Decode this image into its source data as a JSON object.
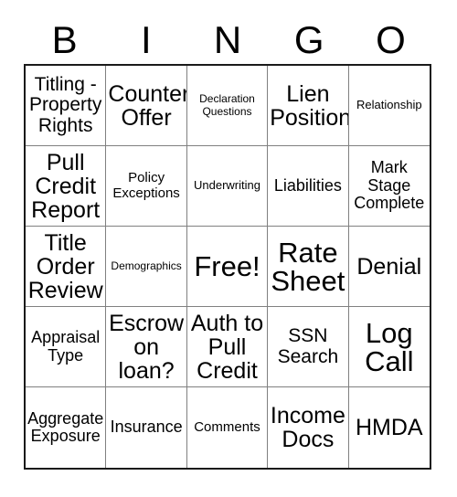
{
  "card": {
    "title": "BINGO",
    "header_letters": [
      "B",
      "I",
      "N",
      "G",
      "O"
    ],
    "free_space_label": "Free!",
    "colors": {
      "background": "#ffffff",
      "text": "#000000",
      "outer_border": "#1a1a1a",
      "inner_border": "#808080"
    },
    "grid": {
      "columns": 5,
      "rows": 5,
      "cells": [
        {
          "label": "Titling -\nProperty\nRights",
          "size": "lg"
        },
        {
          "label": "Counter\nOffer",
          "size": "xl"
        },
        {
          "label": "Declaration\nQuestions",
          "size": "xxs"
        },
        {
          "label": "Lien\nPosition",
          "size": "xl"
        },
        {
          "label": "Relationship",
          "size": "xs"
        },
        {
          "label": "Pull\nCredit\nReport",
          "size": "xl"
        },
        {
          "label": "Policy\nExceptions",
          "size": "sm"
        },
        {
          "label": "Underwriting",
          "size": "xs"
        },
        {
          "label": "Liabilities",
          "size": "md"
        },
        {
          "label": "Mark\nStage\nComplete",
          "size": "md"
        },
        {
          "label": "Title\nOrder\nReview",
          "size": "xl"
        },
        {
          "label": "Demographics",
          "size": "xxs"
        },
        {
          "label": "Free!",
          "size": "xxl"
        },
        {
          "label": "Rate\nSheet",
          "size": "xxl"
        },
        {
          "label": "Denial",
          "size": "xl"
        },
        {
          "label": "Appraisal\nType",
          "size": "md"
        },
        {
          "label": "Escrow\non\nloan?",
          "size": "xl"
        },
        {
          "label": "Auth to\nPull\nCredit",
          "size": "xl"
        },
        {
          "label": "SSN\nSearch",
          "size": "lg"
        },
        {
          "label": "Log\nCall",
          "size": "xxl"
        },
        {
          "label": "Aggregate\nExposure",
          "size": "md"
        },
        {
          "label": "Insurance",
          "size": "md"
        },
        {
          "label": "Comments",
          "size": "sm"
        },
        {
          "label": "Income\nDocs",
          "size": "xl"
        },
        {
          "label": "HMDA",
          "size": "xl"
        }
      ]
    }
  }
}
